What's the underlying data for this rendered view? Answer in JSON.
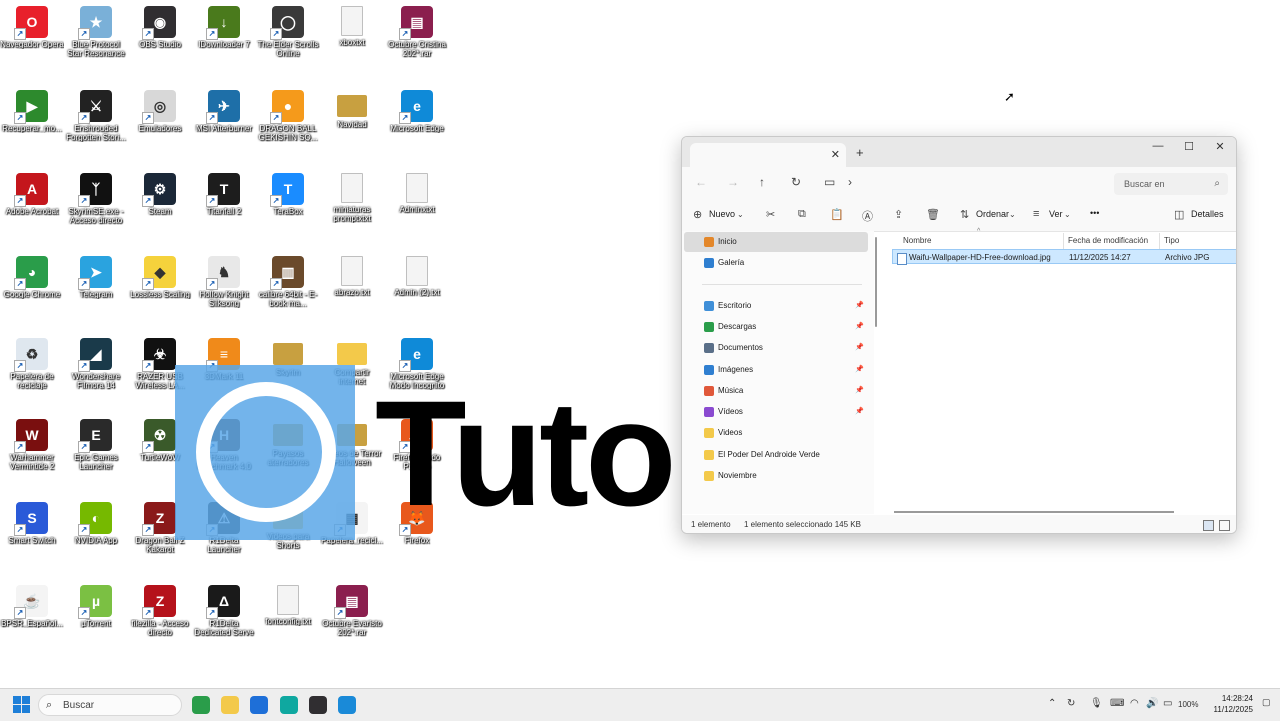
{
  "desktop": {
    "icons": [
      {
        "label": "Navegador Opera",
        "color": "#e8202b",
        "col": 0,
        "row": 0,
        "kind": "app",
        "glyph": "O"
      },
      {
        "label": "Blue Protocol Star Resonance",
        "color": "#7ab0d8",
        "col": 1,
        "row": 0,
        "kind": "app",
        "glyph": "★"
      },
      {
        "label": "OBS Studio",
        "color": "#302e31",
        "col": 2,
        "row": 0,
        "kind": "app",
        "glyph": "◉"
      },
      {
        "label": "IDownloader 7",
        "color": "#4a7a1c",
        "col": 3,
        "row": 0,
        "kind": "app",
        "glyph": "↓"
      },
      {
        "label": "The Elder Scrolls Online",
        "color": "#3a3a3a",
        "col": 4,
        "row": 0,
        "kind": "app",
        "glyph": "◯"
      },
      {
        "label": "xboxtxt",
        "color": "#f4f4f4",
        "col": 5,
        "row": 0,
        "kind": "doc",
        "glyph": ""
      },
      {
        "label": "Octubre Cristina 202*.rar",
        "color": "#8b1f4e",
        "col": 6,
        "row": 0,
        "kind": "app",
        "glyph": "▤"
      },
      {
        "label": "Recuperar_mo...",
        "color": "#2d8a2d",
        "col": 0,
        "row": 1,
        "kind": "app",
        "glyph": "▶"
      },
      {
        "label": "Enshrouded Forgotten Stori...",
        "color": "#222222",
        "col": 1,
        "row": 1,
        "kind": "app",
        "glyph": "⚔"
      },
      {
        "label": "Emuladores",
        "color": "#d8d8d8",
        "col": 2,
        "row": 1,
        "kind": "app",
        "glyph": "◎"
      },
      {
        "label": "MSI Afterburner",
        "color": "#1e6fa8",
        "col": 3,
        "row": 1,
        "kind": "app",
        "glyph": "✈"
      },
      {
        "label": "DRAGON BALL GEKISHIN SQ...",
        "color": "#f59a1b",
        "col": 4,
        "row": 1,
        "kind": "app",
        "glyph": "●"
      },
      {
        "label": "Navidad",
        "color": "#c8a040",
        "col": 5,
        "row": 1,
        "kind": "folder",
        "glyph": ""
      },
      {
        "label": "Microsoft Edge",
        "color": "#0f8ad8",
        "col": 6,
        "row": 1,
        "kind": "app",
        "glyph": "e"
      },
      {
        "label": "Adobe Acrobat",
        "color": "#c4161c",
        "col": 0,
        "row": 2,
        "kind": "app",
        "glyph": "A"
      },
      {
        "label": "SkyrimSE.exe - Acceso directo",
        "color": "#111111",
        "col": 1,
        "row": 2,
        "kind": "app",
        "glyph": "ᛉ"
      },
      {
        "label": "Steam",
        "color": "#1b2838",
        "col": 2,
        "row": 2,
        "kind": "app",
        "glyph": "⚙"
      },
      {
        "label": "Titanfall 2",
        "color": "#1d1d1d",
        "col": 3,
        "row": 2,
        "kind": "app",
        "glyph": "T"
      },
      {
        "label": "TeraBox",
        "color": "#1a8cff",
        "col": 4,
        "row": 2,
        "kind": "app",
        "glyph": "T"
      },
      {
        "label": "miniaturas promptxtxt",
        "color": "#f4f4f4",
        "col": 5,
        "row": 2,
        "kind": "doc",
        "glyph": ""
      },
      {
        "label": "Adminxtxt",
        "color": "#f4f4f4",
        "col": 6,
        "row": 2,
        "kind": "doc",
        "glyph": ""
      },
      {
        "label": "Google Chrome",
        "color": "#2a9d4a",
        "col": 0,
        "row": 3,
        "kind": "app",
        "glyph": "◕"
      },
      {
        "label": "Telegram",
        "color": "#2aa3df",
        "col": 1,
        "row": 3,
        "kind": "app",
        "glyph": "➤"
      },
      {
        "label": "Lossless Scaling",
        "color": "#f5d23c",
        "col": 2,
        "row": 3,
        "kind": "app",
        "glyph": "◆"
      },
      {
        "label": "Hollow Knight Silksong",
        "color": "#e8e8e8",
        "col": 3,
        "row": 3,
        "kind": "app",
        "glyph": "♞"
      },
      {
        "label": "calibre 64bit - E-book ma...",
        "color": "#6b4a2b",
        "col": 4,
        "row": 3,
        "kind": "app",
        "glyph": "▥"
      },
      {
        "label": "abrazo.txt",
        "color": "#f4f4f4",
        "col": 5,
        "row": 3,
        "kind": "doc",
        "glyph": ""
      },
      {
        "label": "Admin (2).txt",
        "color": "#f4f4f4",
        "col": 6,
        "row": 3,
        "kind": "doc",
        "glyph": ""
      },
      {
        "label": "Papelera de reciclaje",
        "color": "#dfe7ef",
        "col": 0,
        "row": 4,
        "kind": "app",
        "glyph": "♻"
      },
      {
        "label": "Wondershare Filmora 14",
        "color": "#1a3a4a",
        "col": 1,
        "row": 4,
        "kind": "app",
        "glyph": "◢"
      },
      {
        "label": "RAZER USB Wireless LA...",
        "color": "#111111",
        "col": 2,
        "row": 4,
        "kind": "app",
        "glyph": "☣"
      },
      {
        "label": "3DMark 11",
        "color": "#f08a1a",
        "col": 3,
        "row": 4,
        "kind": "app",
        "glyph": "≡"
      },
      {
        "label": "Skyrim",
        "color": "#c8a040",
        "col": 4,
        "row": 4,
        "kind": "folder",
        "glyph": ""
      },
      {
        "label": "Compartir internet",
        "color": "#f3c94a",
        "col": 5,
        "row": 4,
        "kind": "folder",
        "glyph": ""
      },
      {
        "label": "Microsoft Edge Modo Incognito",
        "color": "#0f8ad8",
        "col": 6,
        "row": 4,
        "kind": "app",
        "glyph": "e"
      },
      {
        "label": "Warhammer Vermintide 2",
        "color": "#7a0f0f",
        "col": 0,
        "row": 5,
        "kind": "app",
        "glyph": "W"
      },
      {
        "label": "Epic Games Launcher",
        "color": "#2a2a2a",
        "col": 1,
        "row": 5,
        "kind": "app",
        "glyph": "E"
      },
      {
        "label": "TurtleWoW",
        "color": "#3a5a2a",
        "col": 2,
        "row": 5,
        "kind": "app",
        "glyph": "☢"
      },
      {
        "label": "Heaven Benchmark 4.0",
        "color": "#4a2a1a",
        "col": 3,
        "row": 5,
        "kind": "app",
        "glyph": "H"
      },
      {
        "label": "Payasos aterradores",
        "color": "#c8a040",
        "col": 4,
        "row": 5,
        "kind": "folder",
        "glyph": ""
      },
      {
        "label": "Videos de Terror Halloween",
        "color": "#c8a040",
        "col": 5,
        "row": 5,
        "kind": "folder",
        "glyph": ""
      },
      {
        "label": "Firefox Modo Privado",
        "color": "#e8581c",
        "col": 6,
        "row": 5,
        "kind": "app",
        "glyph": "🦊"
      },
      {
        "label": "Smart Switch",
        "color": "#2a5ad8",
        "col": 0,
        "row": 6,
        "kind": "app",
        "glyph": "S"
      },
      {
        "label": "NVIDIA App",
        "color": "#76b900",
        "col": 1,
        "row": 6,
        "kind": "app",
        "glyph": "◐"
      },
      {
        "label": "Dragon Ball Z Kakarot",
        "color": "#8a1a1a",
        "col": 2,
        "row": 6,
        "kind": "app",
        "glyph": "Z"
      },
      {
        "label": "R1Delta Launcher",
        "color": "#222222",
        "col": 3,
        "row": 6,
        "kind": "app",
        "glyph": "⚠"
      },
      {
        "label": "Videos para Shorts",
        "color": "#f3c94a",
        "col": 4,
        "row": 6,
        "kind": "folder",
        "glyph": ""
      },
      {
        "label": "Papelera_recicl...",
        "color": "#f4f4f4",
        "col": 5,
        "row": 6,
        "kind": "app",
        "glyph": "▦"
      },
      {
        "label": "Firefox",
        "color": "#e8581c",
        "col": 6,
        "row": 6,
        "kind": "app",
        "glyph": "🦊"
      },
      {
        "label": "BPSR_Español...",
        "color": "#f4f4f4",
        "col": 0,
        "row": 7,
        "kind": "app",
        "glyph": "☕"
      },
      {
        "label": "µTorrent",
        "color": "#7bc043",
        "col": 1,
        "row": 7,
        "kind": "app",
        "glyph": "µ"
      },
      {
        "label": "filezilla - Acceso directo",
        "color": "#b5121b",
        "col": 2,
        "row": 7,
        "kind": "app",
        "glyph": "Z"
      },
      {
        "label": "R1Delta Dedicated Serve",
        "color": "#1a1a1a",
        "col": 3,
        "row": 7,
        "kind": "app",
        "glyph": "Δ"
      },
      {
        "label": "fontconfig.txt",
        "color": "#f4f4f4",
        "col": 4,
        "row": 7,
        "kind": "doc",
        "glyph": ""
      },
      {
        "label": "Octubre Evaristo 202*.rar",
        "color": "#8b1f4e",
        "col": 5,
        "row": 7,
        "kind": "app",
        "glyph": "▤"
      }
    ],
    "watermark_text": "Tuto"
  },
  "explorer": {
    "new_tab_symbol": "+",
    "tab_close_symbol": "✕",
    "window_buttons": [
      "—",
      "☐",
      "✕"
    ],
    "search_placeholder": "Buscar en",
    "commands": {
      "new": "Nuevo",
      "sort": "Ordenar",
      "view": "Ver",
      "more": "•••",
      "details": "Detalles"
    },
    "nav": [
      {
        "label": "Inicio",
        "color": "#e3872a",
        "selected": true,
        "pinned": false
      },
      {
        "label": "Galería",
        "color": "#2f7fd0",
        "selected": false,
        "pinned": false
      },
      {
        "label": "Escritorio",
        "color": "#3f8fd8",
        "selected": false,
        "pinned": true
      },
      {
        "label": "Descargas",
        "color": "#2a9d4a",
        "selected": false,
        "pinned": true
      },
      {
        "label": "Documentos",
        "color": "#5a6f88",
        "selected": false,
        "pinned": true
      },
      {
        "label": "Imágenes",
        "color": "#2f7fd0",
        "selected": false,
        "pinned": true
      },
      {
        "label": "Música",
        "color": "#e0583a",
        "selected": false,
        "pinned": true
      },
      {
        "label": "Vídeos",
        "color": "#8a4ad0",
        "selected": false,
        "pinned": true
      },
      {
        "label": "Videos",
        "color": "#f3c94a",
        "selected": false,
        "pinned": false
      },
      {
        "label": "El Poder Del Androide Verde",
        "color": "#f3c94a",
        "selected": false,
        "pinned": false
      },
      {
        "label": "Noviembre",
        "color": "#f3c94a",
        "selected": false,
        "pinned": false
      }
    ],
    "columns": {
      "name": "Nombre",
      "modified": "Fecha de modificación",
      "type": "Tipo"
    },
    "file": {
      "name": "Waifu-Wallpaper-HD-Free-download.jpg",
      "modified": "11/12/2025 14:27",
      "type": "Archivo JPG"
    },
    "status": {
      "count": "1 elemento",
      "selected": "1 elemento seleccionado  145 KB"
    }
  },
  "taskbar": {
    "search_placeholder": "Buscar",
    "apps": [
      {
        "name": "chrome",
        "color": "#2a9d4a"
      },
      {
        "name": "explorer",
        "color": "#f3c94a"
      },
      {
        "name": "store",
        "color": "#1e6fd8"
      },
      {
        "name": "edge",
        "color": "#0fa8a0"
      },
      {
        "name": "obs",
        "color": "#302e31"
      },
      {
        "name": "notepad",
        "color": "#1a8ad8"
      }
    ],
    "battery": "100%",
    "time": "14:28:24",
    "date": "11/12/2025"
  }
}
